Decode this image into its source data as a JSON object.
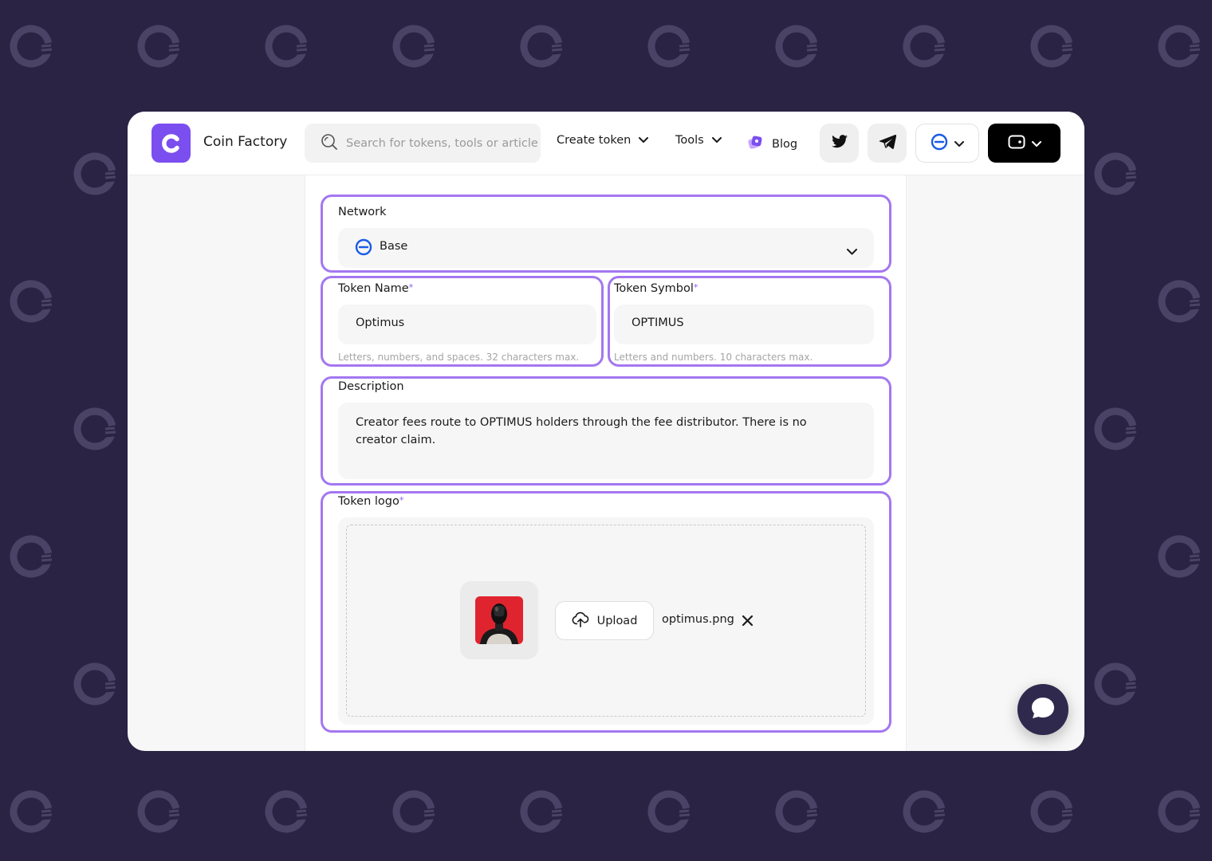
{
  "brand": {
    "name": "Coin Factory",
    "accent": "#7b4ef0"
  },
  "search": {
    "placeholder": "Search for tokens, tools or articles"
  },
  "nav": {
    "create_token": "Create token",
    "tools": "Tools",
    "blog": "Blog"
  },
  "form": {
    "network": {
      "label": "Network",
      "value": "Base"
    },
    "token_name": {
      "label": "Token Name",
      "required": "*",
      "value": "Optimus",
      "hint": "Letters, numbers, and spaces. 32 characters max."
    },
    "token_symbol": {
      "label": "Token Symbol",
      "required": "*",
      "value": "OPTIMUS",
      "hint": "Letters and numbers. 10 characters max."
    },
    "description": {
      "label": "Description",
      "value": "Creator fees route to OPTIMUS holders through the fee distributor. There is no creator claim."
    },
    "token_logo": {
      "label": "Token logo",
      "required": "*",
      "upload_label": "Upload",
      "file_name": "optimus.png"
    }
  },
  "colors": {
    "background": "#2a2343",
    "highlight": "#a477f0",
    "base_blue": "#1a5be6"
  }
}
